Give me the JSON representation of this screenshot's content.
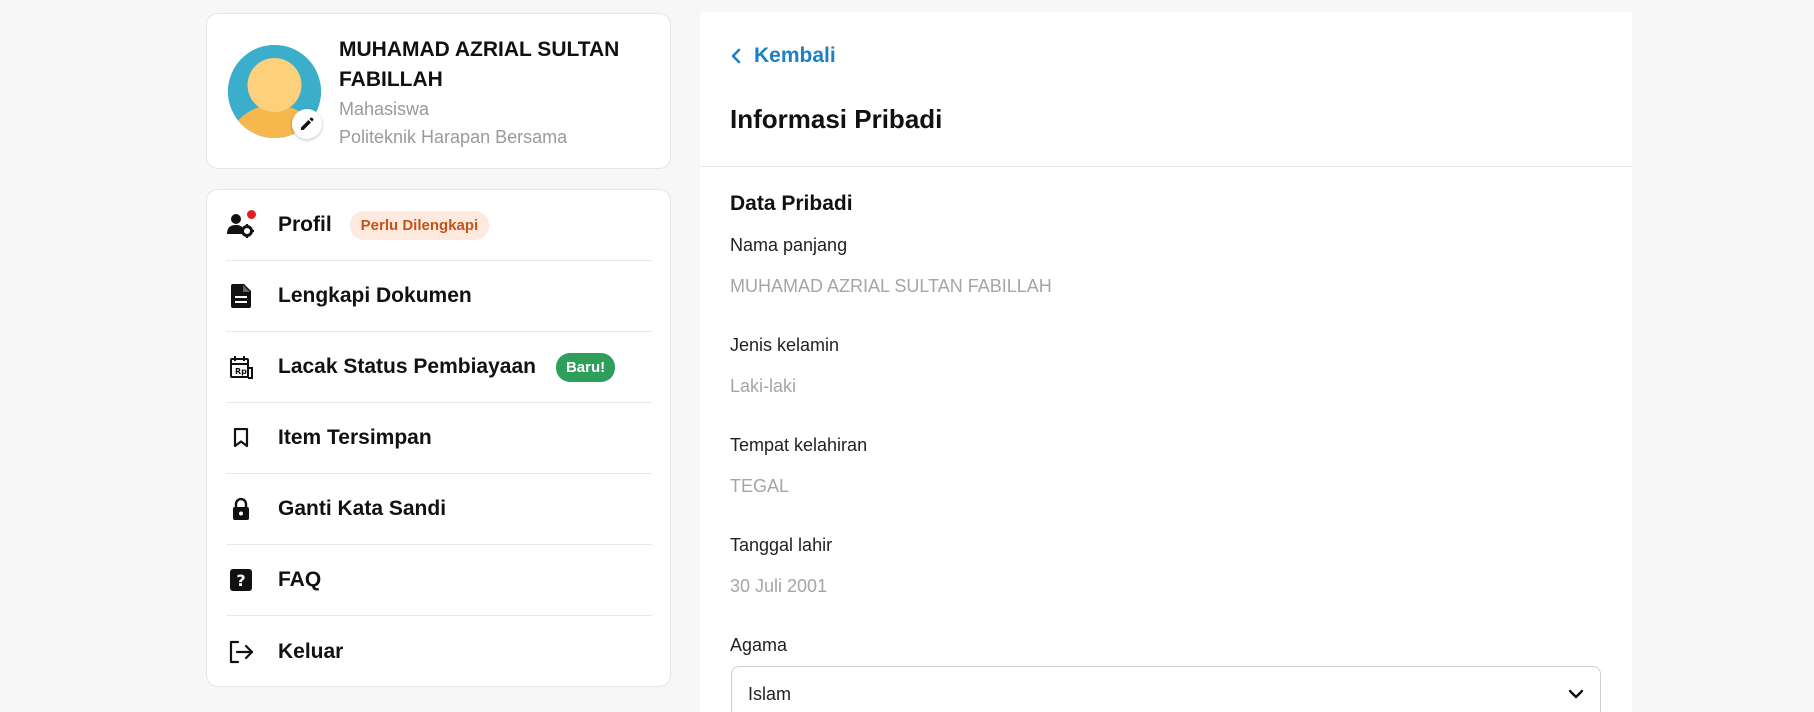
{
  "profile": {
    "name": "MUHAMAD AZRIAL SULTAN FABILLAH",
    "role": "Mahasiswa",
    "institution": "Politeknik Harapan Bersama",
    "avatar_icon": "user-avatar-icon",
    "edit_icon": "pencil-icon"
  },
  "menu": {
    "items": [
      {
        "label": "Profil",
        "icon": "user-gear-icon",
        "badge": "Perlu Dilengkapi"
      },
      {
        "label": "Lengkapi Dokumen",
        "icon": "document-icon"
      },
      {
        "label": "Lacak Status Pembiayaan",
        "icon": "calendar-receipt-icon",
        "badge": "Baru!"
      },
      {
        "label": "Item Tersimpan",
        "icon": "bookmark-icon"
      },
      {
        "label": "Ganti Kata Sandi",
        "icon": "lock-icon"
      },
      {
        "label": "FAQ",
        "icon": "help-icon"
      },
      {
        "label": "Keluar",
        "icon": "logout-icon"
      }
    ]
  },
  "main": {
    "back_label": "Kembali",
    "title": "Informasi Pribadi",
    "section_title": "Data Pribadi",
    "fields": [
      {
        "label": "Nama panjang",
        "value": "MUHAMAD AZRIAL SULTAN FABILLAH"
      },
      {
        "label": "Jenis kelamin",
        "value": "Laki-laki"
      },
      {
        "label": "Tempat kelahiran",
        "value": "TEGAL"
      },
      {
        "label": "Tanggal lahir",
        "value": "30 Juli 2001"
      }
    ],
    "religion": {
      "label": "Agama",
      "value": "Islam"
    }
  },
  "colors": {
    "accent": "#1c80c4",
    "badge_warn_bg": "#fde9de",
    "badge_warn_text": "#c2541b",
    "badge_new_bg": "#2e9e5b",
    "muted_text": "#a5a5a5"
  }
}
